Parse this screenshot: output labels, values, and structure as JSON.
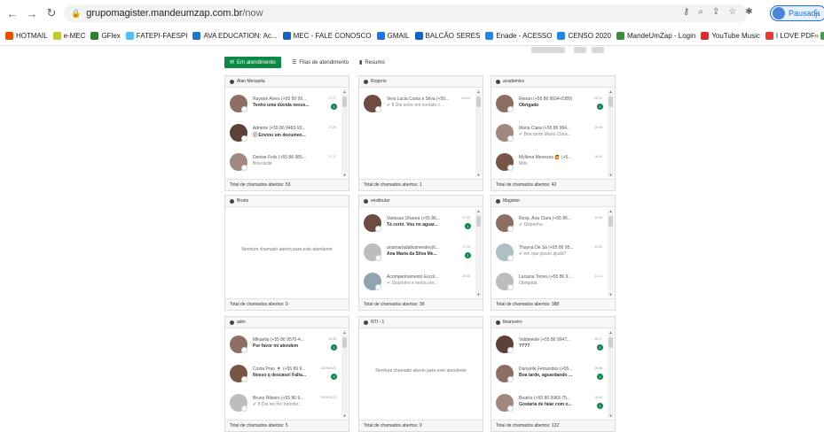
{
  "browser": {
    "url_host": "grupomagister.mandeumzap.com.br",
    "url_path": "/now",
    "profile_label": "Pausada",
    "bookmarks": [
      "HOTMAIL",
      "e-MEC",
      "GFlex",
      "FATEPI-FAESPI",
      "AVA EDUCATION: Ac...",
      "MEC - FALE CONOSCO",
      "GMAIL",
      "BALCÃO SERES",
      "Enade - ACESSO",
      "CENSO 2020",
      "MandeUmZap - Login",
      "YouTube Music",
      "I LOVE PDF",
      "WhatsApp"
    ],
    "bookmark_colors": [
      "#e65100",
      "#c0ca33",
      "#2e7d32",
      "#4fc3f7",
      "#1976d2",
      "#1565c0",
      "#1a73e8",
      "#1565c0",
      "#1e88e5",
      "#1e88e5",
      "#388e3c",
      "#d32f2f",
      "#e53935",
      "#43a047"
    ]
  },
  "tabs": {
    "attendance": "Em atendimento",
    "queues": "Filas de atendimento",
    "summary": "Resumo"
  },
  "empty_text": "Nenhum chamado aberto para este atendente",
  "panels": [
    {
      "title": "Alan Mesquita",
      "footer": "Total de chamados abertos: 53",
      "items": [
        {
          "name": "Rayane Alves (+55 99 99...",
          "msg": "Tenho uma dúvida nesse...",
          "time": "17:27",
          "badge": "1",
          "color": "#8d6e63",
          "light": false
        },
        {
          "name": "Adriene (+55 86 9483-93...",
          "msg": "Ⓘ Enviou um documen...",
          "time": "17:26",
          "badge": "",
          "color": "#5d4037",
          "light": false
        },
        {
          "name": "Denise Felix (+55 86 985...",
          "msg": "Boa tarde",
          "time": "17:17",
          "badge": "",
          "color": "#a1887f",
          "light": true
        }
      ]
    },
    {
      "title": "Rogerio",
      "footer": "Total de chamados abertos: 1",
      "items": [
        {
          "name": "Vera Lucia Costa e Silva (+55...",
          "msg": "✔ 8 Dia entre em contato c...",
          "time": "ontem",
          "badge": "",
          "color": "#6d4c41",
          "light": true
        }
      ]
    },
    {
      "title": "academico",
      "footer": "Total de chamados abertos: 42",
      "items": [
        {
          "name": "Renan (+55 86 8694-0380)",
          "msg": "Obrigado",
          "time": "08:13",
          "badge": "1",
          "color": "#8d6e63",
          "light": false
        },
        {
          "name": "Maria Clara (+55 86 994...",
          "msg": "✔ Boa tarde Maria Clara...",
          "time": "16:46",
          "badge": "",
          "color": "#a1887f",
          "light": true
        },
        {
          "name": "Myllena Menezes 🙋 (+5...",
          "msg": "Mds",
          "time": "16:34",
          "badge": "",
          "color": "#795548",
          "light": true
        }
      ]
    },
    {
      "title": "Bruno",
      "footer": "Total de chamados abertos: 0",
      "items": []
    },
    {
      "title": "vestibular",
      "footer": "Total de chamados abertos: 39",
      "items": [
        {
          "name": "Vanessa Oliveira (+55 86...",
          "msg": "Tá certo. Vou no aguar...",
          "time": "17:25",
          "badge": "1",
          "color": "#6d4c41",
          "light": false
        },
        {
          "name": "anamariadalkamendes(6...",
          "msg": "Ana Maria da Silva Me...",
          "time": "17:05",
          "badge": "1",
          "color": "#bdbdbd",
          "light": false
        },
        {
          "name": "Acompanhamento Escol...",
          "msg": "✔ Disponho e tenha um...",
          "time": "16:48",
          "badge": "",
          "color": "#90a4ae",
          "light": true
        }
      ]
    },
    {
      "title": "Magister",
      "footer": "Total de chamados abertos: 388",
      "items": [
        {
          "name": "Resp. Ana Clara (+55 86...",
          "msg": "✔ Disponha",
          "time": "12:08",
          "badge": "",
          "color": "#8d6e63",
          "light": true
        },
        {
          "name": "Thayná De Sá (+55 86 95...",
          "msg": "✔ em que posso ajudá?",
          "time": "12:00",
          "badge": "",
          "color": "#b0bec5",
          "light": true
        },
        {
          "name": "Luciana Torres (+55 86 9...",
          "msg": "Obrigada",
          "time": "12:11",
          "badge": "",
          "color": "#bdbdbd",
          "light": true
        }
      ]
    },
    {
      "title": "adm",
      "footer": "Total de chamados abertos: 5",
      "items": [
        {
          "name": "Mikaella (+55 86 9570-4...",
          "msg": "Por favor mi atendem",
          "time": "16:38",
          "badge": "1",
          "color": "#8d6e63",
          "light": false
        },
        {
          "name": "Costa Prao 🍷 (+55 86 9...",
          "msg": "Nosso q descaso! Falta...",
          "time": "16/09/2023",
          "badge": "3",
          "color": "#795548",
          "light": false
        },
        {
          "name": "Bruno Ribeiro (+55 86 9...",
          "msg": "✔ 8 Dia ive lhe transfer...",
          "time": "05/09/2023",
          "badge": "",
          "color": "#bdbdbd",
          "light": true
        }
      ]
    },
    {
      "title": "NTI - 1",
      "footer": "Total de chamados abertos: 0",
      "items": []
    },
    {
      "title": "financeiro",
      "footer": "Total de chamados abertos: 122",
      "items": [
        {
          "name": "Valdineide (+55 86 9947...",
          "msg": "????",
          "time": "16:27",
          "badge": "1",
          "color": "#5d4037",
          "light": false
        },
        {
          "name": "Danyelle Fernandes (+55...",
          "msg": "Boa tarde, aguardando ...",
          "time": "16:58",
          "badge": "1",
          "color": "#8d6e63",
          "light": false
        },
        {
          "name": "Beatriz (+55 86 9983-75...",
          "msg": "Gostaria de falar com o...",
          "time": "16:30",
          "badge": "1",
          "color": "#a1887f",
          "light": false
        }
      ]
    }
  ]
}
